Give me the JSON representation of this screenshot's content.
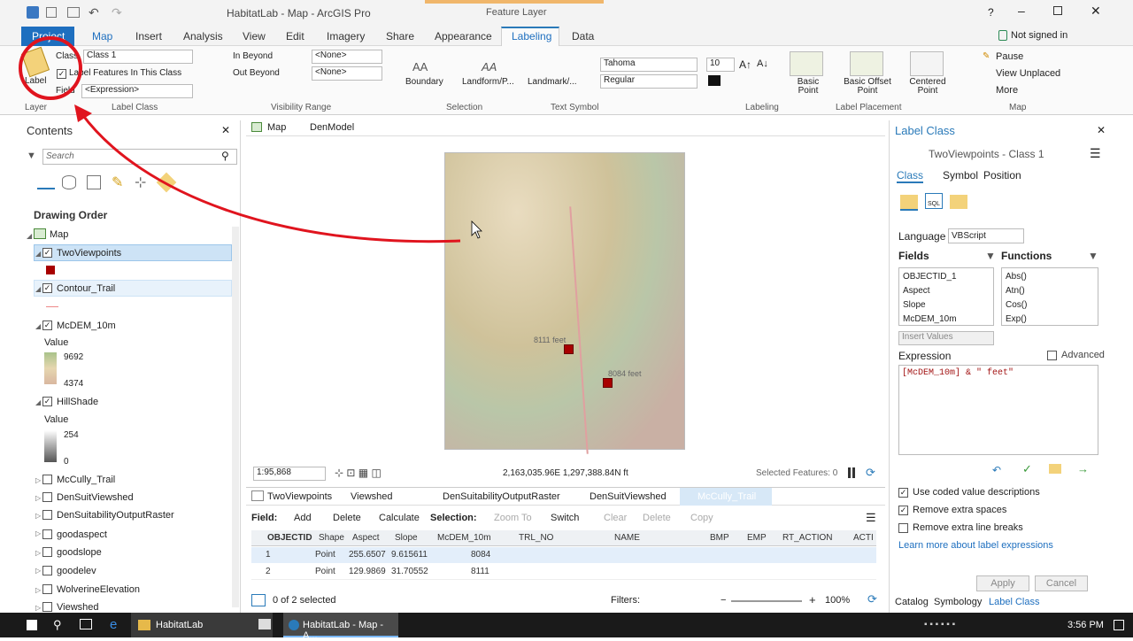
{
  "window": {
    "title": "HabitatLab - Map - ArcGIS Pro",
    "contextual_layer": "Feature Layer",
    "signin": "Not signed in",
    "help": "?"
  },
  "tabs": {
    "project": "Project",
    "map": "Map",
    "insert": "Insert",
    "analysis": "Analysis",
    "view": "View",
    "edit": "Edit",
    "imagery": "Imagery",
    "share": "Share",
    "appearance": "Appearance",
    "labeling": "Labeling",
    "data": "Data"
  },
  "ribbon": {
    "label_btn": "Label",
    "class_label": "Class",
    "class_value": "Class 1",
    "label_features": "Label Features In This Class",
    "field_label": "Field",
    "field_value": "<Expression>",
    "in_beyond": "In Beyond",
    "out_beyond": "Out Beyond",
    "none1": "<None>",
    "none2": "<None>",
    "boundary": "Boundary",
    "landform": "Landform/P...",
    "landmark": "Landmark/...",
    "font": "Tahoma",
    "size": "10",
    "style": "Regular",
    "basic_point": "Basic Point",
    "basic_offset": "Basic Offset Point",
    "centered_point": "Centered Point",
    "pause": "Pause",
    "view_unplaced": "View Unplaced",
    "more": "More",
    "groups": {
      "layer": "Layer",
      "label_class": "Label Class",
      "visibility_range": "Visibility Range",
      "selection": "Selection",
      "text_symbol": "Text Symbol",
      "label_placement": "Label Placement",
      "map": "Map",
      "labeling": "Labeling"
    }
  },
  "contents": {
    "title": "Contents",
    "search_placeholder": "Search",
    "drawing_order": "Drawing Order",
    "map": "Map",
    "layers": [
      "TwoViewpoints",
      "Contour_Trail",
      "McDEM_10m",
      "HillShade",
      "McCully_Trail",
      "DenSuitViewshed",
      "DenSuitabilityOutputRaster",
      "goodaspect",
      "goodslope",
      "goodelev",
      "WolverineElevation",
      "Viewshed"
    ],
    "value_label": "Value",
    "dem_high": "9692",
    "dem_low": "4374",
    "hs_high": "254",
    "hs_low": "0"
  },
  "mapview": {
    "tab_map": "Map",
    "tab_denmodel": "DenModel",
    "label1": "8111 feet",
    "label2": "8084 feet",
    "scale": "1:95,868",
    "coords": "2,163,035.96E 1,297,388.84N ft",
    "selected": "Selected Features: 0"
  },
  "attr": {
    "tabs": [
      "TwoViewpoints",
      "Viewshed",
      "DenSuitabilityOutputRaster",
      "DenSuitViewshed",
      "McCully_Trail"
    ],
    "field": "Field:",
    "add": "Add",
    "delete": "Delete",
    "calculate": "Calculate",
    "selection": "Selection:",
    "zoom_to": "Zoom To",
    "switch": "Switch",
    "clear": "Clear",
    "delete2": "Delete",
    "copy": "Copy",
    "columns": [
      "OBJECTID",
      "Shape",
      "Aspect",
      "Slope",
      "McDEM_10m",
      "TRL_NO",
      "NAME",
      "BMP",
      "EMP",
      "RT_ACTION",
      "ACTI"
    ],
    "rows": [
      {
        "id": "1",
        "shape": "Point",
        "aspect": "255.6507",
        "slope": "9.615611",
        "dem": "8084"
      },
      {
        "id": "2",
        "shape": "Point",
        "aspect": "129.9869",
        "slope": "31.70552",
        "dem": "8111"
      }
    ],
    "status": "0 of 2 selected",
    "filters": "Filters:",
    "zoom": "100%"
  },
  "labelclass": {
    "title": "Label Class",
    "subtitle": "TwoViewpoints - Class 1",
    "tab_class": "Class",
    "tab_symbol": "Symbol",
    "tab_position": "Position",
    "language_label": "Language",
    "language_value": "VBScript",
    "fields_label": "Fields",
    "functions_label": "Functions",
    "fields": [
      "OBJECTID_1",
      "Aspect",
      "Slope",
      "McDEM_10m"
    ],
    "functions": [
      "Abs()",
      "Atn()",
      "Cos()",
      "Exp()"
    ],
    "insert_values": "Insert Values",
    "expression_label": "Expression",
    "advanced": "Advanced",
    "expression": "[McDEM_10m] & \" feet\"",
    "coded_values": "Use coded value descriptions",
    "remove_spaces": "Remove extra spaces",
    "remove_breaks": "Remove extra line breaks",
    "learn_more": "Learn more about label expressions",
    "apply": "Apply",
    "cancel": "Cancel",
    "bottom_tabs": [
      "Catalog",
      "Symbology",
      "Label Class"
    ]
  },
  "taskbar": {
    "habitatlab": "HabitatLab",
    "arcgis": "HabitatLab - Map - A...",
    "time": "3:56 PM"
  },
  "colors": {
    "accent": "#2a7ab9",
    "project_tab": "#1e6fbf",
    "annotation_red": "#e0141e",
    "point_marker": "#a80000"
  }
}
